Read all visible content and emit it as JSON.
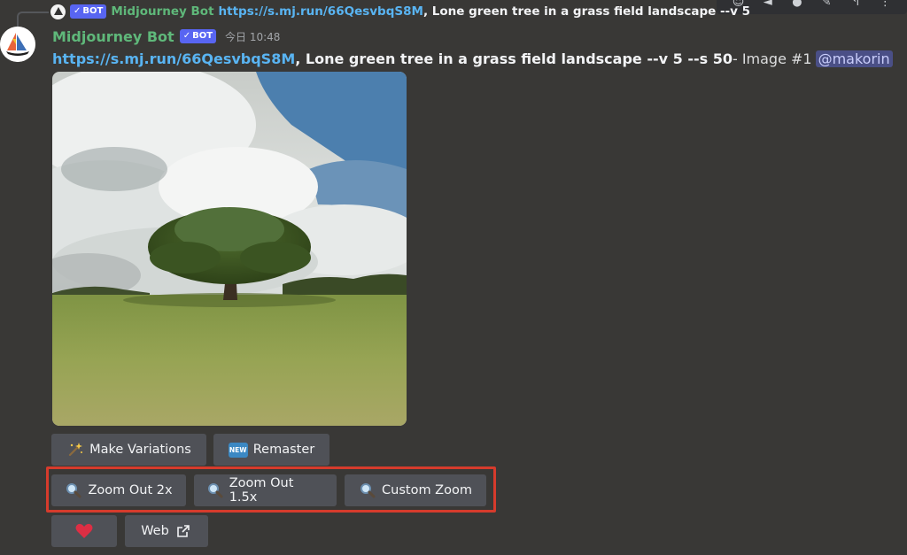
{
  "reply": {
    "bot_label": "BOT",
    "username": "Midjourney Bot",
    "link": "https://s.mj.run/66QesvbqS8M",
    "prompt": ", Lone green tree in a grass field landscape --v 5"
  },
  "message": {
    "username": "Midjourney Bot",
    "bot_label": "BOT",
    "timestamp": "今日 10:48",
    "link": "https://s.mj.run/66QesvbqS8M",
    "prompt": ", Lone green tree in a grass field landscape --v 5 --s 50",
    "suffix": " - Image #1",
    "mention": "@makorin"
  },
  "buttons": {
    "make_variations": "Make Variations",
    "remaster": "Remaster",
    "remaster_badge": "NEW",
    "zoom_out_2x": "Zoom Out 2x",
    "zoom_out_15x": "Zoom Out 1.5x",
    "custom_zoom": "Custom Zoom",
    "web": "Web"
  },
  "icons": {
    "magic-wand": "magic-wand-icon",
    "new-badge": "new-badge-icon",
    "magnifier": "magnifier-icon",
    "heart": "heart-icon",
    "external-link": "external-link-icon"
  },
  "colors": {
    "background": "#393836",
    "username": "#5fb87a",
    "link": "#59b4f2",
    "button": "#4f5157",
    "highlight": "#d63b2c",
    "heart": "#dd2e44"
  }
}
